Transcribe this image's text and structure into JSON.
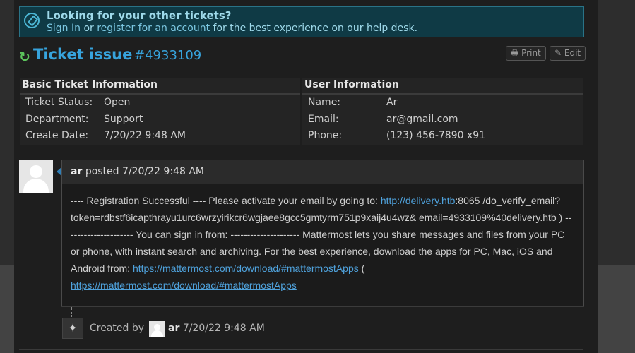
{
  "notice": {
    "title": "Looking for your other tickets?",
    "sign_in": "Sign In",
    "or": "or",
    "register": "register for an account",
    "rest": "for the best experience on our help desk."
  },
  "ticket": {
    "title": "Ticket issue",
    "number": "#4933109",
    "print_label": "Print",
    "edit_label": "Edit"
  },
  "basic_info": {
    "heading": "Basic Ticket Information",
    "rows": [
      {
        "label": "Ticket Status:",
        "value": "Open"
      },
      {
        "label": "Department:",
        "value": "Support"
      },
      {
        "label": "Create Date:",
        "value": "7/20/22 9:48 AM"
      }
    ]
  },
  "user_info": {
    "heading": "User Information",
    "rows": [
      {
        "label": "Name:",
        "value": "Ar"
      },
      {
        "label": "Email:",
        "value": "ar@gmail.com"
      },
      {
        "label": "Phone:",
        "value": "(123) 456-7890 x91"
      }
    ]
  },
  "message": {
    "author": "ar",
    "posted": "posted",
    "date": "7/20/22 9:48 AM",
    "text1": "---- Registration Successful ---- Please activate your email by going to: ",
    "link1": "http://delivery.htb",
    "text2": ":8065 /do_verify_email?token=rdbstf6icapthrayu1urc6wrzyirikcr6wgjaee8gcc5gmtyrm751p9xaij4u4wz& email=4933109%40delivery.htb ) --------------------- You can sign in from: --------------------- Mattermost lets you share messages and files from your PC or phone, with instant search and archiving. For the best experience, download the apps for PC, Mac, iOS and Android from: ",
    "link2": "https://mattermost.com/download/#mattermostApps",
    "text3": " ( ",
    "link3": "https://mattermost.com/download/#mattermostApps"
  },
  "event": {
    "created_by": "Created by",
    "author": "ar",
    "date": "7/20/22 9:48 AM"
  }
}
